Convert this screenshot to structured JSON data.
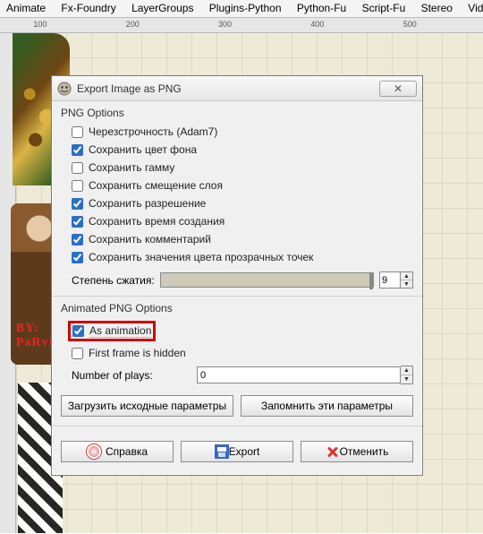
{
  "menubar": {
    "items": [
      "Animate",
      "Fx-Foundry",
      "LayerGroups",
      "Plugins-Python",
      "Python-Fu",
      "Script-Fu",
      "Stereo",
      "Video"
    ]
  },
  "ruler": {
    "marks": [
      "100",
      "200",
      "300",
      "400",
      "500"
    ]
  },
  "art": {
    "signature": "BY: PaRvIz"
  },
  "dialog": {
    "title": "Export Image as PNG",
    "close_glyph": "✕",
    "png": {
      "heading": "PNG Options",
      "opts": [
        {
          "label": "Черезстрочность (Adam7)",
          "checked": false
        },
        {
          "label": "Сохранить цвет фона",
          "checked": true
        },
        {
          "label": "Сохранить гамму",
          "checked": false
        },
        {
          "label": "Сохранить смещение слоя",
          "checked": false
        },
        {
          "label": "Сохранить разрешение",
          "checked": true
        },
        {
          "label": "Сохранить время создания",
          "checked": true
        },
        {
          "label": "Сохранить комментарий",
          "checked": true
        },
        {
          "label": "Сохранить значения цвета прозрачных точек",
          "checked": true
        }
      ],
      "compression_label": "Степень сжатия:",
      "compression_value": "9"
    },
    "apng": {
      "heading": "Animated PNG Options",
      "as_animation": {
        "label": "As animation",
        "checked": true
      },
      "first_hidden": {
        "label": "First frame is hidden",
        "checked": false
      },
      "plays_label": "Number of plays:",
      "plays_value": "0"
    },
    "buttons": {
      "load_defaults": "Загрузить исходные параметры",
      "save_defaults": "Запомнить эти параметры",
      "help": "Справка",
      "export": "Export",
      "cancel": "Отменить"
    }
  }
}
